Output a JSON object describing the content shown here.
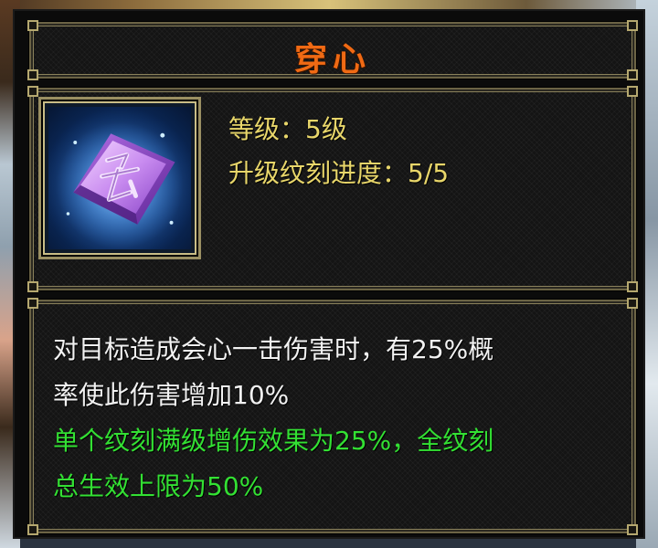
{
  "tooltip": {
    "title": "穿心",
    "level": {
      "label": "等级：",
      "value": "5级"
    },
    "progress": {
      "label": "升级纹刻进度：",
      "value": "5/5"
    },
    "icon": "purple-rune-crystal-icon",
    "description_white": [
      "对目标造成会心一击伤害时，有25%概",
      "率使此伤害增加10%"
    ],
    "description_green": [
      "单个纹刻满级增伤效果为25%，全纹刻",
      "总生效上限为50%"
    ]
  },
  "colors": {
    "title": "#f06a14",
    "stat_text": "#e8d66a",
    "description": "#f2f2f2",
    "description_highlight": "#33e033",
    "frame": "#8a815b"
  }
}
